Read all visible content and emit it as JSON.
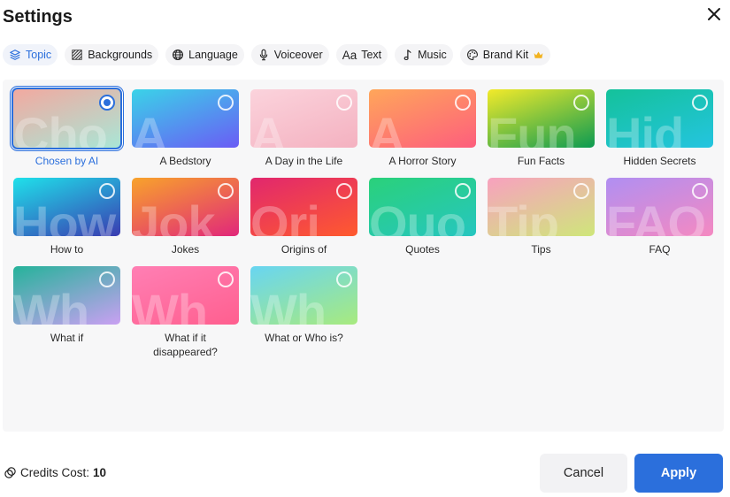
{
  "dialog": {
    "title": "Settings",
    "close_icon": "close-icon"
  },
  "tabs": [
    {
      "label": "Topic",
      "icon": "layers-icon",
      "active": true
    },
    {
      "label": "Backgrounds",
      "icon": "hatch-icon"
    },
    {
      "label": "Language",
      "icon": "globe-icon"
    },
    {
      "label": "Voiceover",
      "icon": "microphone-icon"
    },
    {
      "label": "Text",
      "icon": "text-aa-icon",
      "icon_text": "Aa"
    },
    {
      "label": "Music",
      "icon": "music-note-icon"
    },
    {
      "label": "Brand Kit",
      "icon": "palette-icon",
      "badge_icon": "crown-icon"
    }
  ],
  "topics": [
    {
      "label": "Chosen by AI",
      "watermark": "Cho",
      "selected": true,
      "colors": [
        "#f2a9a0",
        "#a9e6d6"
      ]
    },
    {
      "label": "A Bedstory",
      "watermark": "A",
      "colors": [
        "#3ad3e8",
        "#6a5cf5"
      ]
    },
    {
      "label": "A Day in the Life",
      "watermark": "A",
      "colors": [
        "#fbd3dc",
        "#f4b1c0"
      ]
    },
    {
      "label": "A Horror Story",
      "watermark": "A",
      "colors": [
        "#ffa65a",
        "#fd5e7d"
      ]
    },
    {
      "label": "Fun Facts",
      "watermark": "Fun",
      "colors": [
        "#f3ea2a",
        "#0c9b52"
      ]
    },
    {
      "label": "Hidden Secrets",
      "watermark": "Hid",
      "colors": [
        "#14c29a",
        "#24c4e0"
      ]
    },
    {
      "label": "How to",
      "watermark": "How",
      "colors": [
        "#1fe1ea",
        "#3a3bb1"
      ]
    },
    {
      "label": "Jokes",
      "watermark": "Jok",
      "colors": [
        "#f8a32b",
        "#e1277a"
      ]
    },
    {
      "label": "Origins of",
      "watermark": "Ori",
      "colors": [
        "#e1276e",
        "#ff5a2e"
      ]
    },
    {
      "label": "Quotes",
      "watermark": "Quo",
      "colors": [
        "#2ad17a",
        "#26c6c0"
      ]
    },
    {
      "label": "Tips",
      "watermark": "Tip",
      "colors": [
        "#f8a1bf",
        "#cfe67a"
      ]
    },
    {
      "label": "FAQ",
      "watermark": "FAQ",
      "colors": [
        "#b08ff2",
        "#f589c1"
      ]
    },
    {
      "label": "What if",
      "watermark": "Wh",
      "colors": [
        "#25b39a",
        "#c9a0f2"
      ]
    },
    {
      "label": "What if it disappeared?",
      "watermark": "Wh",
      "colors": [
        "#ff7fb4",
        "#ff5f8f"
      ]
    },
    {
      "label": "What or Who is?",
      "watermark": "Wh",
      "colors": [
        "#68d5f2",
        "#a8ea7e"
      ]
    }
  ],
  "footer": {
    "credits_label": "Credits Cost:",
    "credits_value": "10",
    "credits_icon": "coin-icon",
    "cancel_label": "Cancel",
    "apply_label": "Apply"
  },
  "colors": {
    "accent": "#2b6fdc"
  }
}
